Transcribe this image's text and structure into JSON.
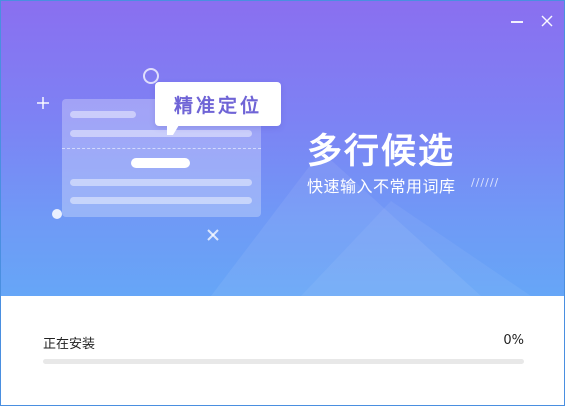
{
  "banner": {
    "bubble_text": "精准定位",
    "title": "多行候选",
    "subtitle": "快速输入不常用词库",
    "decoration": "//////"
  },
  "window_controls": {
    "minimize_icon": "minimize-icon",
    "close_icon": "close-icon"
  },
  "install": {
    "status": "正在安装",
    "percent_text": "0%",
    "progress": 0
  },
  "colors": {
    "banner_top": "#8a6ff0",
    "banner_bottom": "#66a6f7",
    "progress_fill": "#6f8cf5",
    "progress_track": "#e8e8e8"
  }
}
